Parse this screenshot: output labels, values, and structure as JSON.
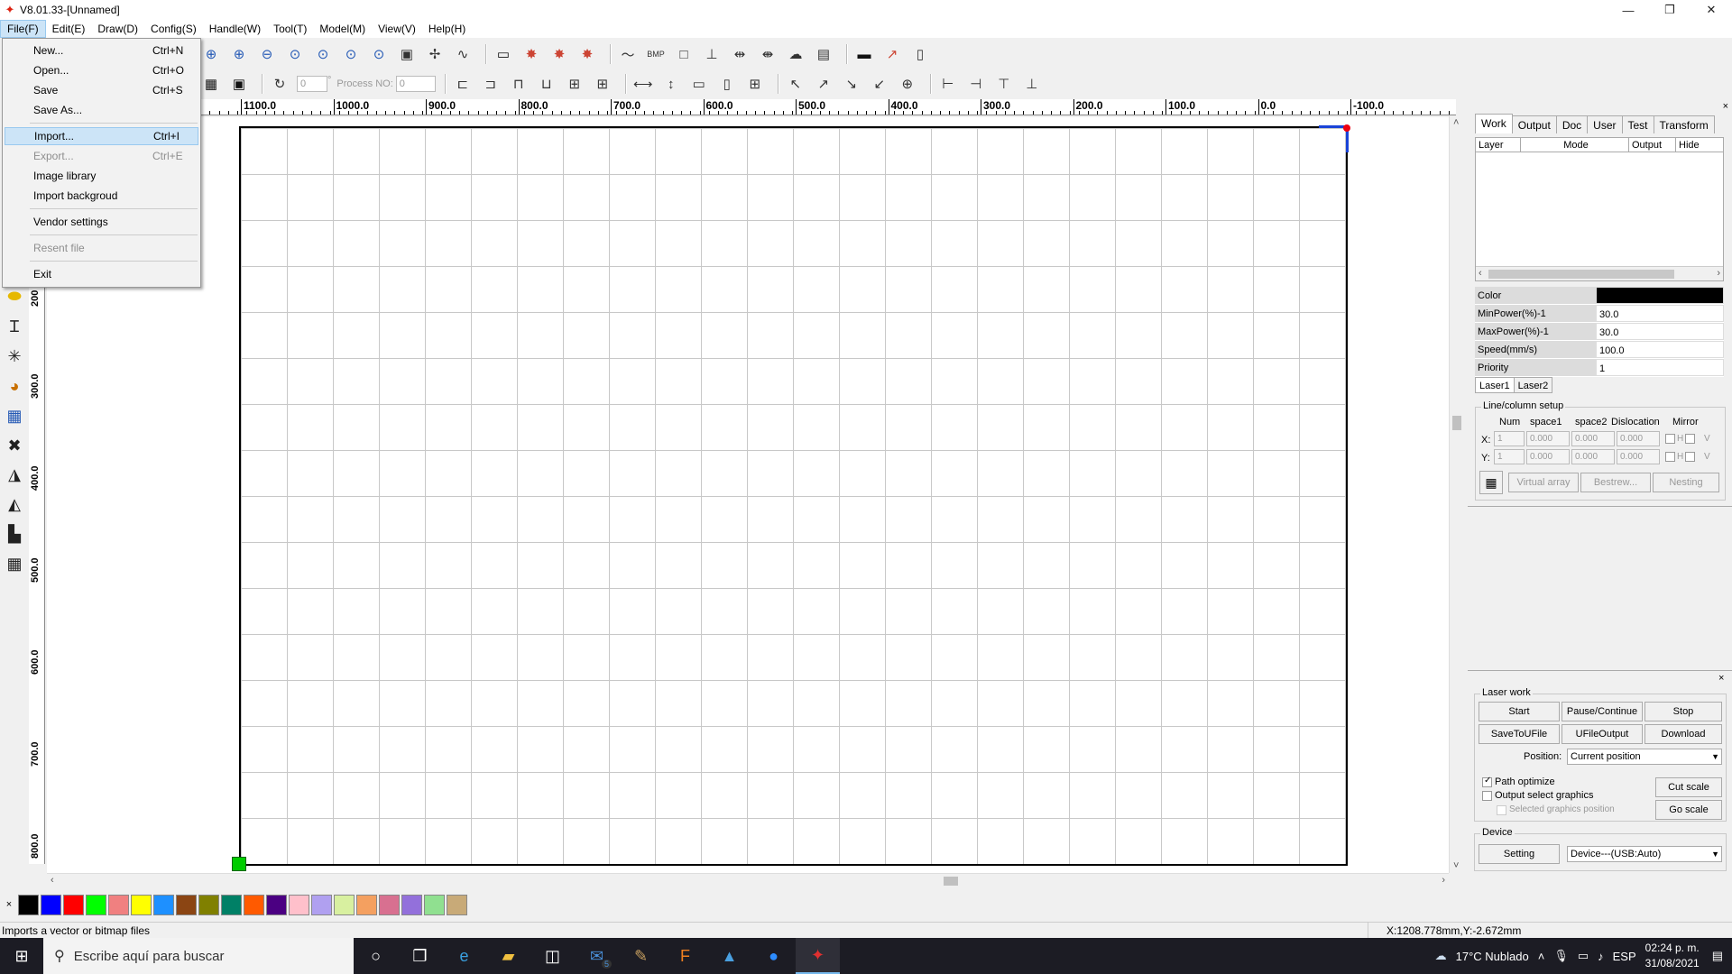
{
  "window": {
    "title": "V8.01.33-[Unnamed]",
    "controls": {
      "minimize": "—",
      "maximize": "❐",
      "close": "✕"
    }
  },
  "menubar": [
    "File(F)",
    "Edit(E)",
    "Draw(D)",
    "Config(S)",
    "Handle(W)",
    "Tool(T)",
    "Model(M)",
    "View(V)",
    "Help(H)"
  ],
  "file_menu": {
    "items": [
      {
        "label": "New...",
        "shortcut": "Ctrl+N",
        "enabled": true
      },
      {
        "label": "Open...",
        "shortcut": "Ctrl+O",
        "enabled": true
      },
      {
        "label": "Save",
        "shortcut": "Ctrl+S",
        "enabled": true
      },
      {
        "label": "Save As...",
        "shortcut": "",
        "enabled": true
      },
      {
        "label": "Import...",
        "shortcut": "Ctrl+I",
        "enabled": true,
        "highlighted": true
      },
      {
        "label": "Export...",
        "shortcut": "Ctrl+E",
        "enabled": false
      },
      {
        "label": "Image library",
        "shortcut": "",
        "enabled": true
      },
      {
        "label": "Import backgroud",
        "shortcut": "",
        "enabled": true
      },
      {
        "label": "Vendor settings",
        "shortcut": "",
        "enabled": true
      },
      {
        "label": "Resent file",
        "shortcut": "",
        "enabled": false
      },
      {
        "label": "Exit",
        "shortcut": "",
        "enabled": true
      }
    ]
  },
  "toolbar2": {
    "rotate_value": "0",
    "degree_symbol": "°",
    "process_label": "Process NO:",
    "process_value": "0"
  },
  "ruler": {
    "horizontal": [
      "1100.0",
      "1000.0",
      "900.0",
      "800.0",
      "700.0",
      "600.0",
      "500.0",
      "400.0",
      "300.0",
      "200.0",
      "100.0",
      "0.0",
      "-100.0"
    ],
    "vertical": [
      "200",
      "300.0",
      "400.0",
      "500.0",
      "600.0",
      "700.0",
      "800.0"
    ]
  },
  "palette": {
    "close": "×",
    "colors": [
      "#000000",
      "#0000ff",
      "#ff0000",
      "#00ff00",
      "#f08080",
      "#ffff00",
      "#1e90ff",
      "#8b4513",
      "#808000",
      "#008066",
      "#ff5a00",
      "#4b0082",
      "#ffc0cb",
      "#b0a0f0",
      "#d8f0a0",
      "#f4a060",
      "#d87090",
      "#9370db",
      "#90e090",
      "#c8aa78"
    ]
  },
  "statusbar": {
    "hint": "Imports a vector or bitmap files",
    "coords": "X:1208.778mm,Y:-2.672mm"
  },
  "panel": {
    "tabs": [
      "Work",
      "Output",
      "Doc",
      "User",
      "Test",
      "Transform"
    ],
    "layer_headers": [
      "Layer",
      "Mode",
      "Output",
      "Hide"
    ],
    "props": [
      {
        "key": "Color",
        "value": ""
      },
      {
        "key": "MinPower(%)-1",
        "value": "30.0"
      },
      {
        "key": "MaxPower(%)-1",
        "value": "30.0"
      },
      {
        "key": "Speed(mm/s)",
        "value": "100.0"
      },
      {
        "key": "Priority",
        "value": "1"
      }
    ],
    "laser_tabs": [
      "Laser1",
      "Laser2"
    ],
    "line_column": {
      "title": "Line/column setup",
      "headers": [
        "Num",
        "space1",
        "space2",
        "Dislocation",
        "Mirror"
      ],
      "row_labels": [
        "X:",
        "Y:"
      ],
      "x_values": [
        "1",
        "0.000",
        "0.000",
        "0.000"
      ],
      "y_values": [
        "1",
        "0.000",
        "0.000",
        "0.000"
      ],
      "mirror_h": "H",
      "mirror_v": "V",
      "buttons": [
        "Virtual array",
        "Bestrew...",
        "Nesting"
      ]
    },
    "laser_work": {
      "title": "Laser work",
      "buttons_row1": [
        "Start",
        "Pause/Continue",
        "Stop"
      ],
      "buttons_row2": [
        "SaveToUFile",
        "UFileOutput",
        "Download"
      ],
      "position_label": "Position:",
      "position_value": "Current position",
      "path_optimize": "Path optimize",
      "output_select": "Output select graphics",
      "selected_position": "Selected graphics position",
      "cut_scale": "Cut scale",
      "go_scale": "Go scale"
    },
    "device": {
      "title": "Device",
      "setting": "Setting",
      "value": "Device---(USB:Auto)"
    }
  },
  "taskbar": {
    "search_placeholder": "Escribe aquí para buscar",
    "mail_badge": "5",
    "weather": "17°C  Nublado",
    "lang": "ESP",
    "time": "02:24 p. m.",
    "date": "31/08/2021"
  }
}
